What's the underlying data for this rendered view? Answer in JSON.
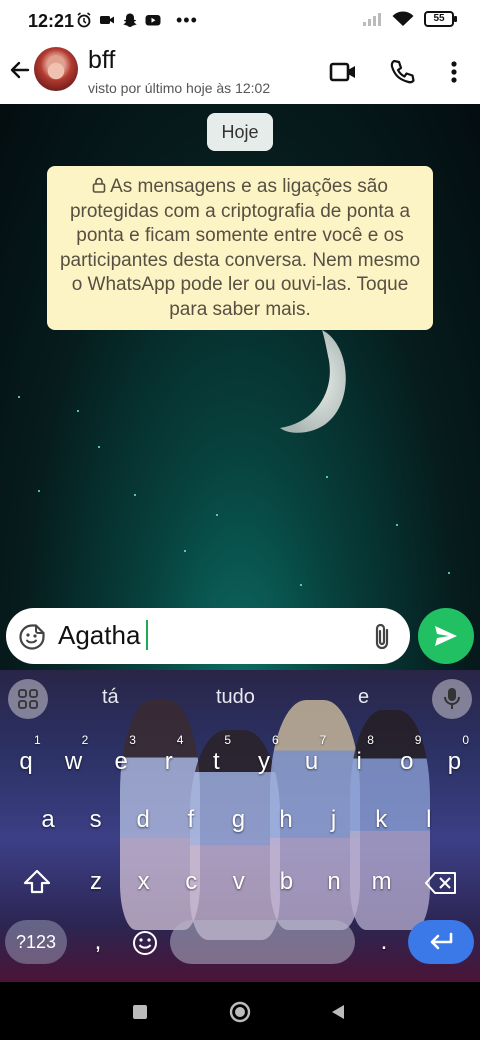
{
  "status_bar": {
    "time": "12:21",
    "dots": "•••",
    "battery": "55",
    "icons": [
      "alarm-icon",
      "video-icon",
      "snapchat-icon",
      "youtube-icon",
      "signal-icon",
      "wifi-icon",
      "battery-icon"
    ]
  },
  "header": {
    "contact_name": "bff",
    "last_seen": "visto por último hoje às 12:02",
    "icons": [
      "back-arrow-icon",
      "video-call-icon",
      "phone-icon",
      "more-vert-icon"
    ]
  },
  "chat": {
    "date_chip": "Hoje",
    "encryption_notice": "As mensagens e as ligações são protegidas com a criptografia de ponta a ponta e ficam somente entre você e os participantes desta conversa. Nem mesmo o WhatsApp pode ler ou ouvi-las. Toque para saber mais."
  },
  "input": {
    "value": "Agatha"
  },
  "keyboard": {
    "suggestions": [
      "tá",
      "tudo",
      "e"
    ],
    "rows": [
      [
        {
          "k": "q",
          "n": "1"
        },
        {
          "k": "w",
          "n": "2"
        },
        {
          "k": "e",
          "n": "3"
        },
        {
          "k": "r",
          "n": "4"
        },
        {
          "k": "t",
          "n": "5"
        },
        {
          "k": "y",
          "n": "6"
        },
        {
          "k": "u",
          "n": "7"
        },
        {
          "k": "i",
          "n": "8"
        },
        {
          "k": "o",
          "n": "9"
        },
        {
          "k": "p",
          "n": "0"
        }
      ],
      [
        {
          "k": "a"
        },
        {
          "k": "s"
        },
        {
          "k": "d"
        },
        {
          "k": "f"
        },
        {
          "k": "g"
        },
        {
          "k": "h"
        },
        {
          "k": "j"
        },
        {
          "k": "k"
        },
        {
          "k": "l"
        }
      ],
      [
        {
          "k": "z"
        },
        {
          "k": "x"
        },
        {
          "k": "c"
        },
        {
          "k": "v"
        },
        {
          "k": "b"
        },
        {
          "k": "n"
        },
        {
          "k": "m"
        }
      ]
    ],
    "symbols_key": "?123",
    "comma_key": ",",
    "period_key": ".",
    "accent_color": "#3b78e8"
  },
  "colors": {
    "send_button": "#21c063",
    "notice_background": "#fdf4c5",
    "chat_background": "#062a2a"
  }
}
